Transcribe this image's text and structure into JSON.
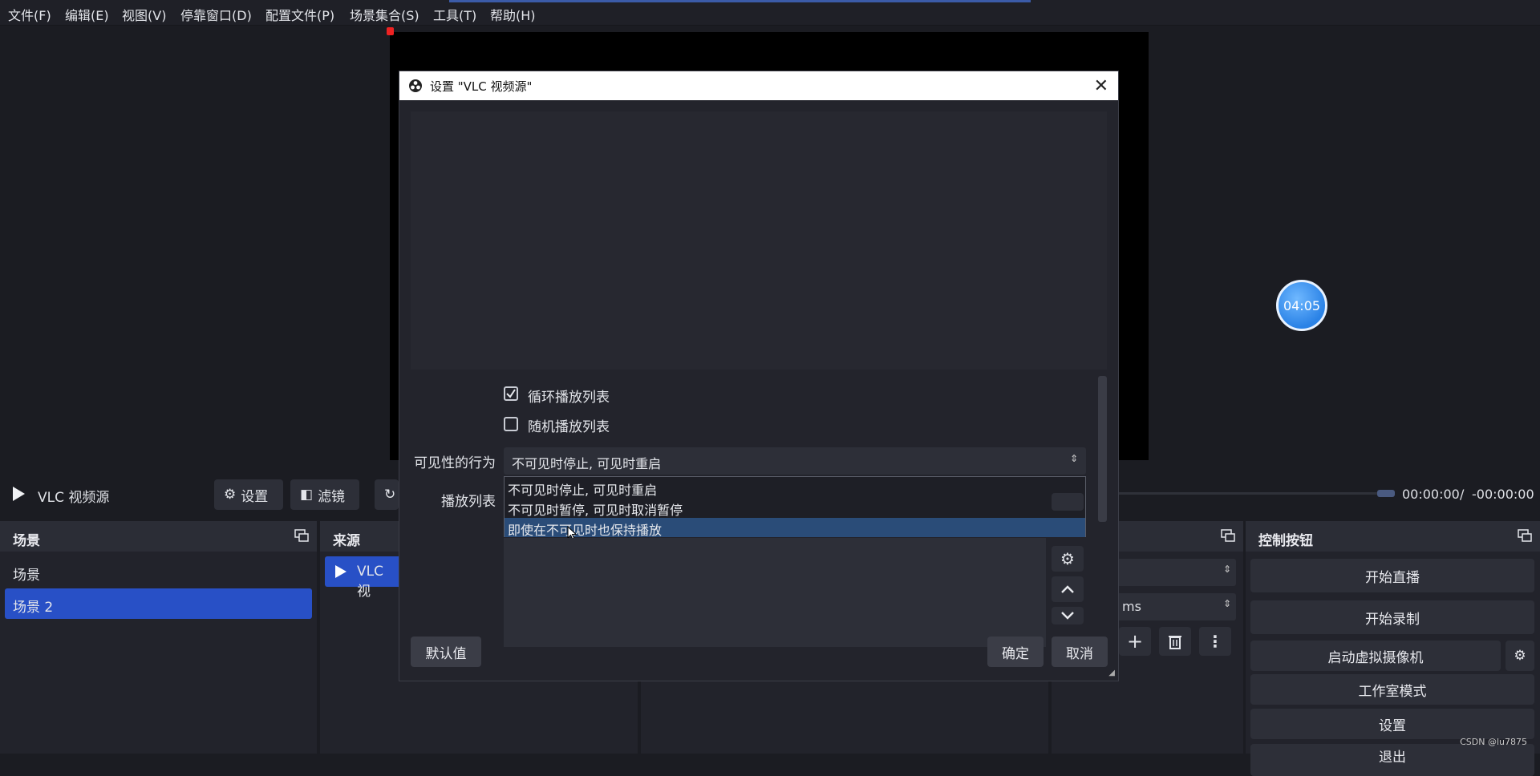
{
  "menu": [
    "文件(F)",
    "编辑(E)",
    "视图(V)",
    "停靠窗口(D)",
    "配置文件(P)",
    "场景集合(S)",
    "工具(T)",
    "帮助(H)"
  ],
  "timer": "04:05",
  "source_bar": {
    "source_name": "VLC 视频源",
    "settings_label": "设置",
    "filters_label": "滤镜",
    "time_current": "00:00:00",
    "time_sep": "/",
    "time_remaining": "-00:00:00",
    "seek_progress": 0.99
  },
  "scenes": {
    "title": "场景",
    "items": [
      "场景",
      "场景 2"
    ],
    "selected": "场景 2"
  },
  "sources": {
    "title": "来源",
    "items": [
      "VLC 视频源"
    ],
    "visible_text": "VLC 视"
  },
  "transition": {
    "duration_suffix": "ms"
  },
  "controls": {
    "title": "控制按钮",
    "start_streaming": "开始直播",
    "start_recording": "开始录制",
    "start_virtual_cam": "启动虚拟摄像机",
    "studio_mode": "工作室模式",
    "settings": "设置",
    "exit": "退出"
  },
  "dialog": {
    "title": "设置 \"VLC 视频源\"",
    "loop_label": "循环播放列表",
    "loop_checked": true,
    "shuffle_label": "随机播放列表",
    "shuffle_checked": false,
    "visibility_label": "可见性的行为",
    "visibility_value": "不可见时停止, 可见时重启",
    "visibility_options": [
      "不可见时停止, 可见时重启",
      "不可见时暂停, 可见时取消暂停",
      "即使在不可见时也保持播放"
    ],
    "highlighted_option": "即使在不可见时也保持播放",
    "playlist_label": "播放列表",
    "defaults_button": "默认值",
    "ok_button": "确定",
    "cancel_button": "取消"
  },
  "watermark": "CSDN @lu7875",
  "colors": {
    "selection": "#2850c6",
    "dropdown_highlight": "#2a4c78",
    "background": "#1b1c22"
  }
}
